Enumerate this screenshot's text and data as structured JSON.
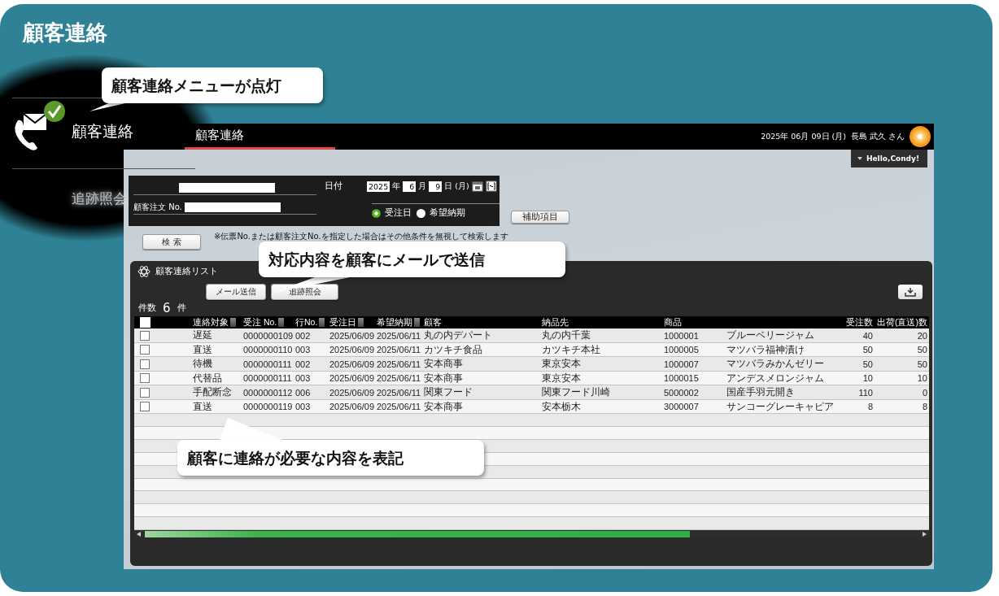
{
  "title": "顧客連絡",
  "callouts": [
    {
      "text": "顧客連絡メニューが点灯"
    },
    {
      "text": "対応内容を顧客にメールで送信"
    },
    {
      "text": "顧客に連絡が必要な内容を表記"
    }
  ],
  "side_menu": [
    {
      "label": "顧客連絡",
      "selected": true
    },
    {
      "label": "追跡照会",
      "selected": false
    }
  ],
  "app": {
    "tab": "顧客連絡",
    "date": "2025年 06月 09日 (月)",
    "user": "長島 武久 さん",
    "greeting": "Hello,Condy!"
  },
  "search": {
    "field_label": "顧客注文 No.",
    "date_label": "日付",
    "year": "2025",
    "year_unit": "年",
    "month": "6",
    "month_unit": "月",
    "day": "9",
    "day_unit": "日",
    "weekday": "(月)",
    "date_basis": [
      {
        "label": "受注日",
        "selected": true
      },
      {
        "label": "希望納期",
        "selected": false
      }
    ],
    "aux_button": "補助項目",
    "search_button": "検 索",
    "note": "※伝票No.または顧客注文No.を指定した場合はその他条件を無視して検索します"
  },
  "list": {
    "title": "顧客連絡リスト",
    "buttons": [
      "メール送信",
      "追跡照会"
    ],
    "count_label": "件数",
    "count": "6",
    "count_unit": "件",
    "all_checked": false,
    "columns": [
      {
        "label": "連絡対象",
        "sortable": true
      },
      {
        "label": "受注 No.",
        "sortable": true
      },
      {
        "label": "行No.",
        "sortable": true
      },
      {
        "label": "受注日",
        "sortable": true
      },
      {
        "label": "希望納期",
        "sortable": true
      },
      {
        "label": "顧客",
        "sortable": false
      },
      {
        "label": "納品先",
        "sortable": false
      },
      {
        "label": "商品",
        "sortable": false
      },
      {},
      {
        "label": "受注数",
        "sortable": false
      },
      {
        "label": "出荷(直送)数",
        "sortable": false
      }
    ],
    "rows": [
      {
        "checked": false,
        "cells": [
          "遅延",
          "0000000109",
          "002",
          "2025/06/09",
          "2025/06/11",
          "丸の内デパート",
          "丸の内千葉",
          "1000001",
          "ブルーベリージャム",
          "40",
          "20"
        ]
      },
      {
        "checked": false,
        "cells": [
          "直送",
          "0000000110",
          "003",
          "2025/06/09",
          "2025/06/11",
          "カツキチ食品",
          "カツキチ本社",
          "1000005",
          "マツバラ福神漬け",
          "50",
          "50"
        ]
      },
      {
        "checked": false,
        "cells": [
          "待機",
          "0000000111",
          "002",
          "2025/06/09",
          "2025/06/11",
          "安本商事",
          "東京安本",
          "1000007",
          "マツバラみかんゼリー",
          "50",
          "50"
        ]
      },
      {
        "checked": false,
        "cells": [
          "代替品",
          "0000000111",
          "003",
          "2025/06/09",
          "2025/06/11",
          "安本商事",
          "東京安本",
          "1000015",
          "アンデスメロンジャム",
          "10",
          "10"
        ]
      },
      {
        "checked": false,
        "cells": [
          "手配断念",
          "0000000112",
          "006",
          "2025/06/09",
          "2025/06/11",
          "関東フード",
          "関東フード川崎",
          "5000002",
          "国産手羽元開き",
          "110",
          "0"
        ]
      },
      {
        "checked": false,
        "cells": [
          "直送",
          "0000000119",
          "003",
          "2025/06/09",
          "2025/06/11",
          "安本商事",
          "安本栃木",
          "3000007",
          "サンコーグレーキャピア",
          "8",
          "8"
        ]
      }
    ]
  }
}
